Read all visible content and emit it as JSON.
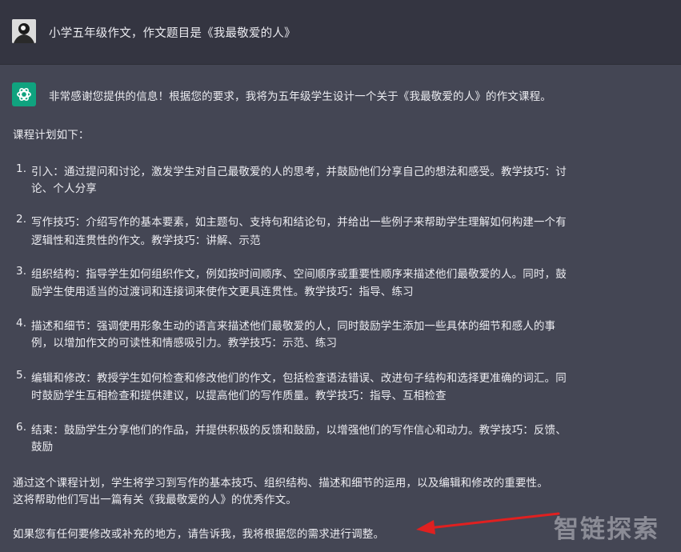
{
  "user_message": "小学五年级作文，作文题目是《我最敬爱的人》",
  "assistant": {
    "intro": "非常感谢您提供的信息！根据您的要求，我将为五年级学生设计一个关于《我最敬爱的人》的作文课程。",
    "plan_heading": "课程计划如下：",
    "items": [
      {
        "number": "1.",
        "lines": [
          "引入：通过提问和讨论，激发学生对自己最敬爱的人的思考，并鼓励他们分享自己的想法和感受。教学技巧：讨",
          "论、个人分享"
        ]
      },
      {
        "number": "2.",
        "lines": [
          "写作技巧：介绍写作的基本要素，如主题句、支持句和结论句，并给出一些例子来帮助学生理解如何构建一个有",
          "逻辑性和连贯性的作文。教学技巧：讲解、示范"
        ]
      },
      {
        "number": "3.",
        "lines": [
          "组织结构：指导学生如何组织作文，例如按时间顺序、空间顺序或重要性顺序来描述他们最敬爱的人。同时，鼓",
          "励学生使用适当的过渡词和连接词来使作文更具连贯性。教学技巧：指导、练习"
        ]
      },
      {
        "number": "4.",
        "lines": [
          "描述和细节：强调使用形象生动的语言来描述他们最敬爱的人，同时鼓励学生添加一些具体的细节和感人的事",
          "例，以增加作文的可读性和情感吸引力。教学技巧：示范、练习"
        ]
      },
      {
        "number": "5.",
        "lines": [
          "编辑和修改：教授学生如何检查和修改他们的作文，包括检查语法错误、改进句子结构和选择更准确的词汇。同",
          "时鼓励学生互相检查和提供建议，以提高他们的写作质量。教学技巧：指导、互相检查"
        ]
      },
      {
        "number": "6.",
        "lines": [
          "结束：鼓励学生分享他们的作品，并提供积极的反馈和鼓励，以增强他们的写作信心和动力。教学技巧：反馈、",
          "鼓励"
        ]
      }
    ],
    "summary_lines": [
      "通过这个课程计划，学生将学习到写作的基本技巧、组织结构、描述和细节的运用，以及编辑和修改的重要性。",
      "这将帮助他们写出一篇有关《我最敬爱的人》的优秀作文。"
    ],
    "closing": "如果您有任何要修改或补充的地方，请告诉我，我将根据您的需求进行调整。"
  },
  "watermark": "智链探索",
  "colors": {
    "user_bg": "#343541",
    "assistant_bg": "#444654",
    "bot_avatar": "#10a37f",
    "arrow": "#e02020"
  },
  "icons": {
    "user_avatar": "person-avatar-icon",
    "bot_avatar": "chatgpt-logo-icon",
    "annotation": "red-arrow-icon"
  }
}
